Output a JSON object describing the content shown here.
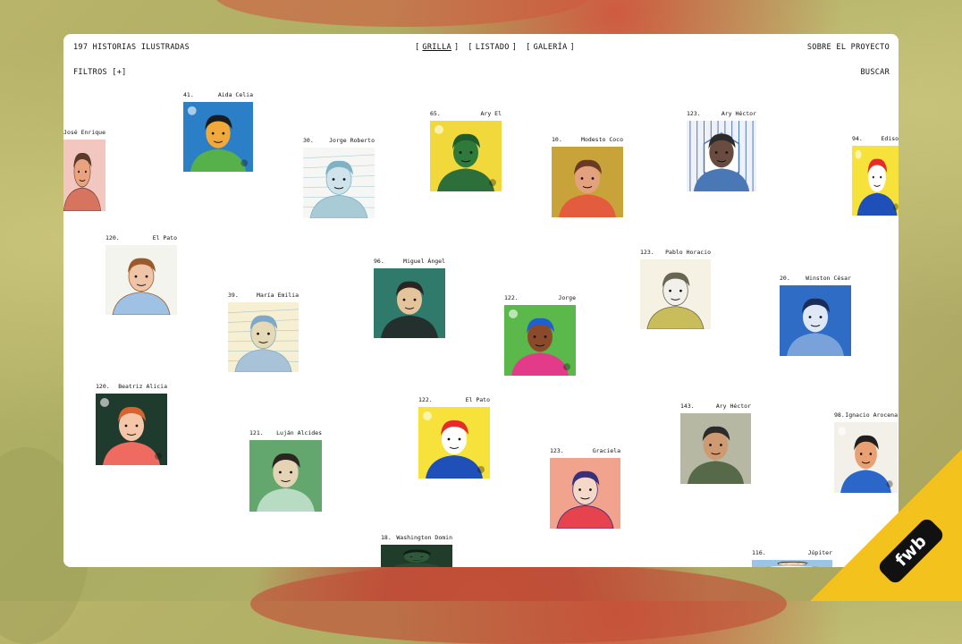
{
  "header": {
    "count_label": "197 HISTORIAS ILUSTRADAS",
    "views": [
      {
        "label": "GRILLA",
        "active": true
      },
      {
        "label": "LISTADO",
        "active": false
      },
      {
        "label": "GALERÍA",
        "active": false
      }
    ],
    "about_label": "SOBRE EL PROYECTO",
    "filters_label": "FILTROS [+]",
    "search_label": "BUSCAR"
  },
  "stories": [
    {
      "num": "",
      "name": "José Enrique",
      "bg": "#f3c6c0",
      "skin": "#e9a37f",
      "hair": "#5a3a2a",
      "shirt": "#d7745f",
      "style": "light"
    },
    {
      "num": "41.",
      "name": "Aida Celia",
      "bg": "#2a7fc7",
      "skin": "#f2a93b",
      "hair": "#1c1c1c",
      "shirt": "#56b14a",
      "style": "bold"
    },
    {
      "num": "30.",
      "name": "Jorge Roberto",
      "bg": "#f6f7f4",
      "skin": "#cfe3ea",
      "hair": "#7fb3c4",
      "shirt": "#a9cbd6",
      "style": "sketch"
    },
    {
      "num": "65.",
      "name": "Ary El",
      "bg": "#f2d93b",
      "skin": "#2e7a3b",
      "hair": "#1f5b2b",
      "shirt": "#2d6f3a",
      "style": "bold"
    },
    {
      "num": "10.",
      "name": "Modesto Coco",
      "bg": "#c8a33a",
      "skin": "#e3a27d",
      "hair": "#6b3a25",
      "shirt": "#e25c3d",
      "style": "paint"
    },
    {
      "num": "123.",
      "name": "Ary Héctor",
      "bg": "#eef2f8",
      "skin": "#6a4b3f",
      "hair": "#2b2b2b",
      "shirt": "#4a78b7",
      "style": "frame"
    },
    {
      "num": "94.",
      "name": "Edison",
      "bg": "#f6e23a",
      "skin": "#ffffff",
      "hair": "#e62b2b",
      "shirt": "#1f4fb8",
      "style": "bold"
    },
    {
      "num": "120.",
      "name": "El Pato",
      "bg": "#f3f4ee",
      "skin": "#f0c4a6",
      "hair": "#9a5a2c",
      "shirt": "#9fc1e3",
      "style": "light"
    },
    {
      "num": "39.",
      "name": "María Emilia",
      "bg": "#f6efd2",
      "skin": "#e6d9b8",
      "hair": "#7ea8c7",
      "shirt": "#a8c3d8",
      "style": "sketch"
    },
    {
      "num": "96.",
      "name": "Miguel Ángel",
      "bg": "#2f7a6b",
      "skin": "#e5c49c",
      "hair": "#2a2522",
      "shirt": "#23302d",
      "style": "paint"
    },
    {
      "num": "122.",
      "name": "Jorge",
      "bg": "#5bb84a",
      "skin": "#8b4a2a",
      "hair": "#1e5fd1",
      "shirt": "#e33a8a",
      "style": "bold"
    },
    {
      "num": "123.",
      "name": "Pablo Horacio",
      "bg": "#f5f1e3",
      "skin": "#f1f0ea",
      "hair": "#6a6453",
      "shirt": "#c9bc5a",
      "style": "light"
    },
    {
      "num": "20.",
      "name": "Winston César",
      "bg": "#2e6cc6",
      "skin": "#dfe8f4",
      "hair": "#1a2e5a",
      "shirt": "#7aa2da",
      "style": "paint"
    },
    {
      "num": "120.",
      "name": "Beatriz Alicia",
      "bg": "#1f3b2e",
      "skin": "#f5c7a8",
      "hair": "#d9632e",
      "shirt": "#ef6b61",
      "style": "bold"
    },
    {
      "num": "121.",
      "name": "Luján Alcides",
      "bg": "#63a76f",
      "skin": "#e5d3b6",
      "hair": "#2c2621",
      "shirt": "#b8dcc3",
      "style": "paint"
    },
    {
      "num": "122.",
      "name": "El Pato",
      "bg": "#f6e23a",
      "skin": "#ffffff",
      "hair": "#e62b2b",
      "shirt": "#1f4fb8",
      "style": "bold"
    },
    {
      "num": "123.",
      "name": "Graciela",
      "bg": "#f2a38d",
      "skin": "#f4d9c9",
      "hair": "#3a2f7a",
      "shirt": "#e6434f",
      "style": "light"
    },
    {
      "num": "143.",
      "name": "Ary Héctor",
      "bg": "#b7b8a4",
      "skin": "#cf9a72",
      "hair": "#2b2b2b",
      "shirt": "#566a4a",
      "style": "paint"
    },
    {
      "num": "98.",
      "name": "Ignacio Arocena",
      "bg": "#f3f0ea",
      "skin": "#e9a173",
      "hair": "#1f1f1f",
      "shirt": "#2b66c9",
      "style": "bold"
    },
    {
      "num": "18.",
      "name": "Washington Domin",
      "bg": "#1f3d2a",
      "skin": "#2e5a3b",
      "hair": "#0f1a12",
      "shirt": "#2b4a36",
      "style": "paint"
    },
    {
      "num": "116.",
      "name": "Júpiter",
      "bg": "#9bc4e6",
      "skin": "#f1d2b5",
      "hair": "#3a2a1a",
      "shirt": "#ffffff",
      "style": "light"
    }
  ],
  "badge": {
    "label": "fwb",
    "color": "#f4c21c"
  }
}
